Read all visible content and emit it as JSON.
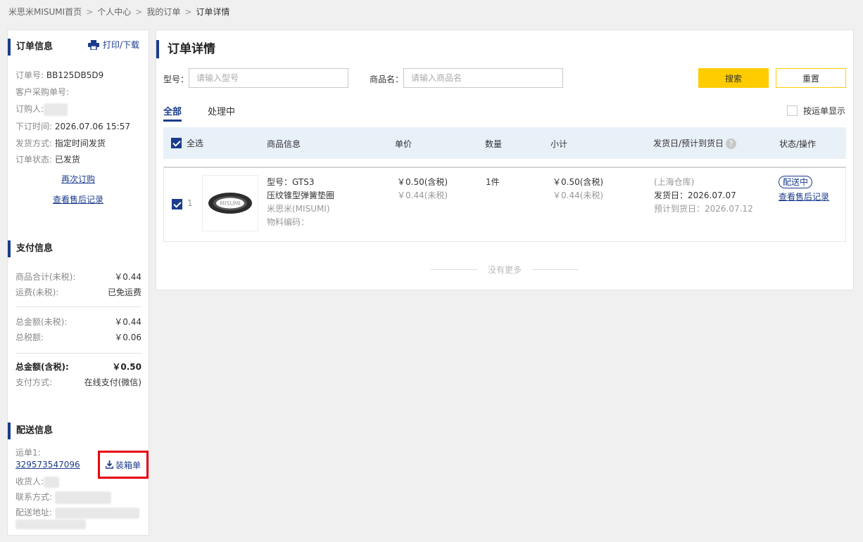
{
  "breadcrumb": {
    "items": [
      "米思米MISUMI首页",
      "个人中心",
      "我的订单"
    ],
    "current": "订单详情",
    "separator": ">"
  },
  "order_info": {
    "title": "订单信息",
    "print_label": "打印/下载",
    "order_no_label": "订单号:",
    "order_no": "BB125DB5D9",
    "customer_po_label": "客户采购单号:",
    "customer_po": "",
    "buyer_label": "订购人:",
    "order_time_label": "下订时间:",
    "order_time": "2026.07.06 15:57",
    "ship_method_label": "发货方式:",
    "ship_method": "指定时间发货",
    "status_label": "订单状态:",
    "status": "已发货",
    "reorder_link": "再次订购",
    "aftersale_link": "查看售后记录"
  },
  "payment_info": {
    "title": "支付信息",
    "rows1": [
      {
        "k": "商品合计(未税):",
        "v": "￥0.44"
      },
      {
        "k": "运费(未税):",
        "v": "已免运费"
      }
    ],
    "rows2": [
      {
        "k": "总金额(未税):",
        "v": "￥0.44"
      },
      {
        "k": "总税额:",
        "v": "￥0.06"
      }
    ],
    "total_label": "总金额(含税):",
    "total_value": "￥0.50",
    "pay_method_label": "支付方式:",
    "pay_method": "在线支付(微信)"
  },
  "delivery_info": {
    "title": "配送信息",
    "waybill_label": "运单1:",
    "waybill_no": "329573547096",
    "packing_list": "装箱单",
    "receiver_label": "收货人:",
    "contact_label": "联系方式:",
    "address_label": "配送地址:"
  },
  "main": {
    "title": "订单详情",
    "model_label": "型号：",
    "model_placeholder": "请输入型号",
    "name_label": "商品名：",
    "name_placeholder": "请输入商品名",
    "search_btn": "搜索",
    "reset_btn": "重置",
    "tabs": [
      "全部",
      "处理中"
    ],
    "waybill_display": "按运单显示",
    "columns": {
      "select_all": "全选",
      "product": "商品信息",
      "unit_price": "单价",
      "qty": "数量",
      "subtotal": "小计",
      "ship_date": "发货日/预计到货日",
      "status": "状态/操作"
    },
    "row": {
      "index": "1",
      "model": "型号：GTS3",
      "name": "压纹锥型弹簧垫圈",
      "brand": "米思米(MISUMI)",
      "material_code": "物料编码：",
      "price_tax": "￥0.50(含税)",
      "price_notax": "￥0.44(未税)",
      "qty": "1件",
      "sub_tax": "￥0.50(含税)",
      "sub_notax": "￥0.44(未税)",
      "warehouse": "(上海仓库)",
      "ship_date": "发货日：2026.07.07",
      "eta": "预计到货日：2026.07.12",
      "status": "配送中",
      "aftersale_link": "查看售后记录",
      "thumb_text": "MISUMI"
    },
    "no_more": "没有更多"
  },
  "colors": {
    "accent": "#1b3c8c",
    "search_button": "#ffcc00",
    "highlight_box": "#e60012"
  }
}
